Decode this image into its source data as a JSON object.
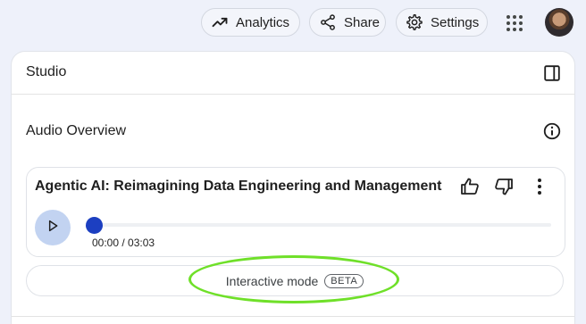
{
  "header": {
    "analytics_label": "Analytics",
    "share_label": "Share",
    "settings_label": "Settings",
    "analytics_icon": "trending-up-icon",
    "share_icon": "share-icon",
    "settings_icon": "gear-icon",
    "apps_icon": "apps-grid-icon",
    "avatar_icon": "user-avatar"
  },
  "studio": {
    "title": "Studio",
    "toggle_icon": "panel-toggle-icon",
    "audio_overview": {
      "title": "Audio Overview",
      "info_icon": "info-icon",
      "audio": {
        "title": "Agentic AI: Reimagining Data Engineering and Management",
        "time": "00:00 / 03:03",
        "progress": 0,
        "play_icon": "play-icon",
        "thumb_up_icon": "thumb-up-icon",
        "thumb_down_icon": "thumb-down-icon",
        "more_icon": "more-vert-icon"
      },
      "interactive_mode": {
        "label": "Interactive mode",
        "badge": "BETA"
      }
    }
  },
  "colors": {
    "accent": "#1c3fc1",
    "play_bg": "#c2d3f1",
    "highlight": "#6fe029",
    "background": "#eef1fa"
  }
}
